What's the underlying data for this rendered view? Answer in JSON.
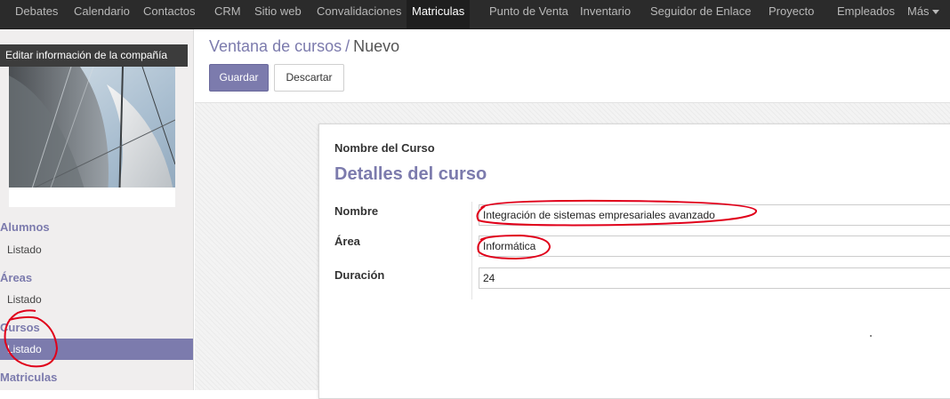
{
  "topbar": {
    "items": [
      "Debates",
      "Calendario",
      "Contactos",
      "CRM",
      "Sitio web",
      "Convalidaciones",
      "Matriculas",
      "Punto de Venta",
      "Inventario",
      "Seguidor de Enlace",
      "Proyecto",
      "Empleados",
      "Más"
    ],
    "active": "Matriculas"
  },
  "sidebar": {
    "company_button": "Editar información de la compañía",
    "sections": [
      {
        "title": "Alumnos",
        "items": [
          "Listado"
        ]
      },
      {
        "title": "Áreas",
        "items": [
          "Listado"
        ]
      },
      {
        "title": "Cursos",
        "items": [
          "Listado"
        ],
        "active_item": "Listado"
      },
      {
        "title": "Matriculas",
        "items": []
      }
    ]
  },
  "header": {
    "breadcrumb_parent": "Ventana de cursos",
    "breadcrumb_separator": "/",
    "breadcrumb_current": "Nuevo",
    "save_label": "Guardar",
    "discard_label": "Descartar"
  },
  "form": {
    "label_top": "Nombre del Curso",
    "title": "Detalles del curso",
    "fields": [
      {
        "label": "Nombre",
        "value": "Integración de sistemas empresariales avanzado"
      },
      {
        "label": "Área",
        "value": "Informática"
      },
      {
        "label": "Duración",
        "value": "24"
      }
    ]
  },
  "colors": {
    "accent": "#7c7bad",
    "topbar": "#2b2b2b",
    "annotation": "#e0001a"
  }
}
